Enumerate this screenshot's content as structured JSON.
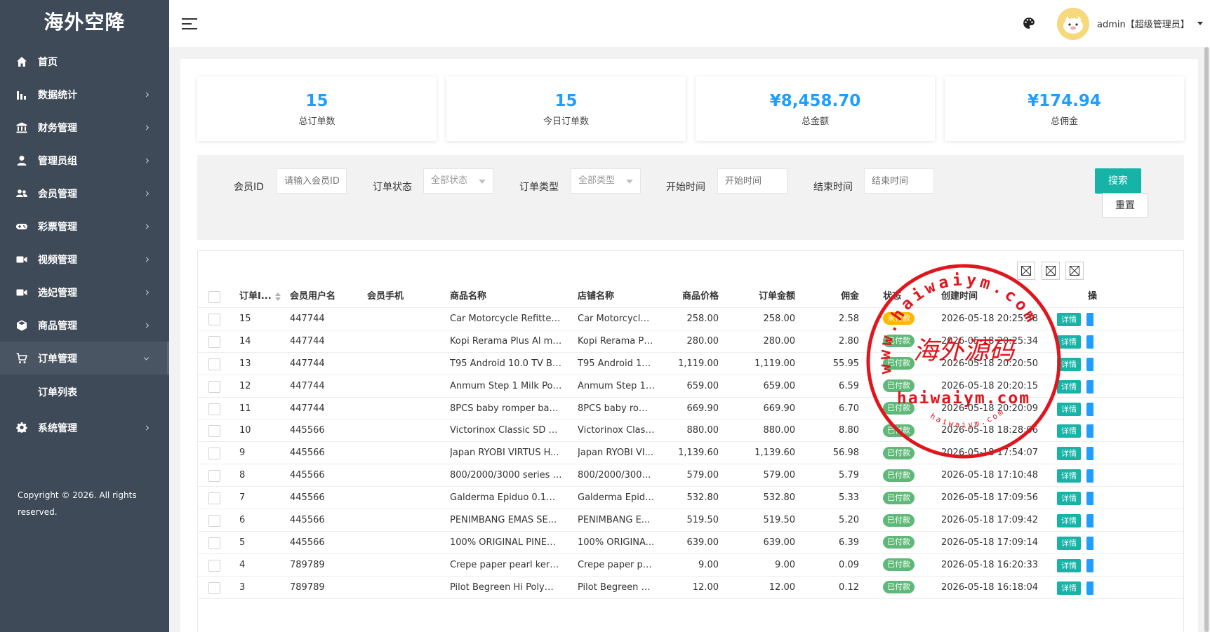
{
  "sidebar": {
    "logo": "海外空降",
    "items": [
      {
        "label": "首页",
        "icon": "home-icon",
        "has_arrow": false
      },
      {
        "label": "数据统计",
        "icon": "bar-chart-icon",
        "has_arrow": true
      },
      {
        "label": "财务管理",
        "icon": "bank-icon",
        "has_arrow": true
      },
      {
        "label": "管理员组",
        "icon": "user-icon",
        "has_arrow": true
      },
      {
        "label": "会员管理",
        "icon": "users-icon",
        "has_arrow": true
      },
      {
        "label": "彩票管理",
        "icon": "gamepad-icon",
        "has_arrow": true
      },
      {
        "label": "视频管理",
        "icon": "video-icon",
        "has_arrow": true
      },
      {
        "label": "选妃管理",
        "icon": "video-icon",
        "has_arrow": true
      },
      {
        "label": "商品管理",
        "icon": "cube-icon",
        "has_arrow": true
      },
      {
        "label": "订单管理",
        "icon": "cart-icon",
        "has_arrow": true,
        "open": true
      },
      {
        "label": "系统管理",
        "icon": "gear-icon",
        "has_arrow": true
      }
    ],
    "submenu": [
      "订单列表"
    ],
    "copyright_line1": "Copyright © 2026. All rights",
    "copyright_line2": "reserved."
  },
  "header": {
    "menu_icon": "hamburger-icon",
    "theme_icon": "palette-icon",
    "user": "admin【超级管理员】"
  },
  "stats": [
    {
      "value": "15",
      "label": "总订单数"
    },
    {
      "value": "15",
      "label": "今日订单数"
    },
    {
      "value": "¥8,458.70",
      "label": "总金额"
    },
    {
      "value": "¥174.94",
      "label": "总佣金"
    }
  ],
  "search": {
    "member_id_label": "会员ID",
    "member_id_placeholder": "请输入会员ID",
    "status_label": "订单状态",
    "status_value": "全部状态",
    "type_label": "订单类型",
    "type_value": "全部类型",
    "start_label": "开始时间",
    "start_placeholder": "开始时间",
    "end_label": "结束时间",
    "end_placeholder": "结束时间",
    "search_button": "搜索",
    "reset_button": "重置"
  },
  "table": {
    "toolbar_icons": [
      "filter-columns-icon",
      "export-icon",
      "print-icon"
    ],
    "columns": [
      "订单I...",
      "会员用户名",
      "会员手机",
      "商品名称",
      "店铺名称",
      "商品价格",
      "订单金额",
      "佣金",
      "状态",
      "创建时间",
      "操"
    ],
    "detail_label": "详情",
    "rows": [
      {
        "id": "15",
        "user": "447744",
        "phone": "",
        "product": "Car Motorcycle Refitted ...",
        "shop": "Car Motorcycle ...",
        "price": "258.00",
        "amount": "258.00",
        "commission": "2.58",
        "status": "未付款",
        "status_type": "unpaid",
        "time": "2026-05-18 20:25:38"
      },
      {
        "id": "14",
        "user": "447744",
        "phone": "",
        "product": "Kopi Rerama Plus Al ma...",
        "shop": "Kopi Rerama Plu...",
        "price": "280.00",
        "amount": "280.00",
        "commission": "2.80",
        "status": "已付款",
        "status_type": "paid",
        "time": "2026-05-18 20:25:34"
      },
      {
        "id": "13",
        "user": "447744",
        "phone": "",
        "product": "T95 Android 10.0 TV Bo...",
        "shop": "T95 Android 10....",
        "price": "1,119.00",
        "amount": "1,119.00",
        "commission": "55.95",
        "status": "已付款",
        "status_type": "paid",
        "time": "2026-05-18 20:20:50"
      },
      {
        "id": "12",
        "user": "447744",
        "phone": "",
        "product": "Anmum Step 1 Milk Pow...",
        "shop": "Anmum Step 1 ...",
        "price": "659.00",
        "amount": "659.00",
        "commission": "6.59",
        "status": "已付款",
        "status_type": "paid",
        "time": "2026-05-18 20:20:15"
      },
      {
        "id": "11",
        "user": "447744",
        "phone": "",
        "product": "8PCS baby romper baby...",
        "shop": "8PCS baby rom...",
        "price": "669.90",
        "amount": "669.90",
        "commission": "6.70",
        "status": "已付款",
        "status_type": "paid",
        "time": "2026-05-18 20:20:09"
      },
      {
        "id": "10",
        "user": "445566",
        "phone": "",
        "product": "Victorinox Classic SD M...",
        "shop": "Victorinox Classi...",
        "price": "880.00",
        "amount": "880.00",
        "commission": "8.80",
        "status": "已付款",
        "status_type": "paid",
        "time": "2026-05-18 18:28:06"
      },
      {
        "id": "9",
        "user": "445566",
        "phone": "",
        "product": "Japan RYOBI VIRTUS H...",
        "shop": "Japan RYOBI VI...",
        "price": "1,139.60",
        "amount": "1,139.60",
        "commission": "56.98",
        "status": "已付款",
        "status_type": "paid",
        "time": "2026-05-18 17:54:07"
      },
      {
        "id": "8",
        "user": "445566",
        "phone": "",
        "product": "800/2000/3000 series co...",
        "shop": "800/2000/3000 s...",
        "price": "579.00",
        "amount": "579.00",
        "commission": "5.79",
        "status": "已付款",
        "status_type": "paid",
        "time": "2026-05-18 17:10:48"
      },
      {
        "id": "7",
        "user": "445566",
        "phone": "",
        "product": "Galderma Epiduo 0.1%/...",
        "shop": "Galderma Epidu...",
        "price": "532.80",
        "amount": "532.80",
        "commission": "5.33",
        "status": "已付款",
        "status_type": "paid",
        "time": "2026-05-18 17:09:56"
      },
      {
        "id": "6",
        "user": "445566",
        "phone": "",
        "product": "PENIMBANG EMAS SE...",
        "shop": "PENIMBANG E...",
        "price": "519.50",
        "amount": "519.50",
        "commission": "5.20",
        "status": "已付款",
        "status_type": "paid",
        "time": "2026-05-18 17:09:42"
      },
      {
        "id": "5",
        "user": "445566",
        "phone": "",
        "product": "100% ORIGINAL PINEN...",
        "shop": "100% ORIGINA...",
        "price": "639.00",
        "amount": "639.00",
        "commission": "6.39",
        "status": "已付款",
        "status_type": "paid",
        "time": "2026-05-18 17:09:14"
      },
      {
        "id": "4",
        "user": "789789",
        "phone": "",
        "product": "Crepe paper pearl kertas...",
        "shop": "Crepe paper pea...",
        "price": "9.00",
        "amount": "9.00",
        "commission": "0.09",
        "status": "已付款",
        "status_type": "paid",
        "time": "2026-05-18 16:20:33"
      },
      {
        "id": "3",
        "user": "789789",
        "phone": "",
        "product": "Pilot Begreen Hi Polyme...",
        "shop": "Pilot Begreen Hi ...",
        "price": "12.00",
        "amount": "12.00",
        "commission": "0.12",
        "status": "已付款",
        "status_type": "paid",
        "time": "2026-05-18 16:18:04"
      }
    ]
  },
  "watermark": {
    "center": "海外源码",
    "url": "haiwaiym.com",
    "ring_top": "www.haiwaiym.com",
    "ring_bottom": "haiwaiym.com",
    "color": "#e0161e"
  }
}
